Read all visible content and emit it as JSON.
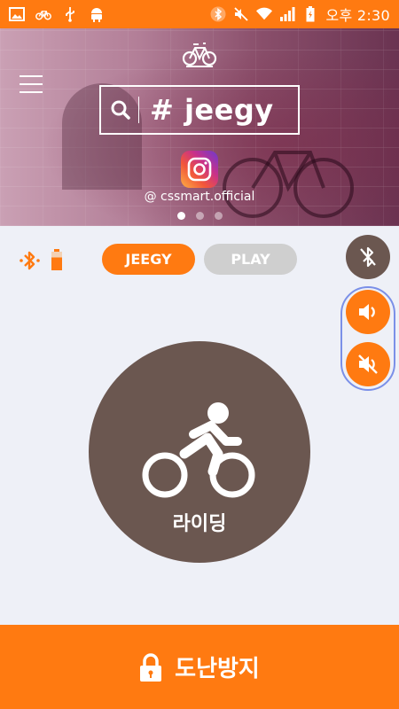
{
  "statusbar": {
    "time": "오후 2:30",
    "left_icons": [
      "image-icon",
      "bike-icon",
      "usb-icon",
      "android-icon"
    ],
    "right_icons": [
      "bluetooth-icon",
      "mute-icon",
      "wifi-icon",
      "signal-icon",
      "battery-icon"
    ]
  },
  "hero": {
    "search_text": "# jeegy",
    "instagram_handle": "@ cssmart.official",
    "carousel_count": 3,
    "carousel_active": 0
  },
  "tabs": [
    {
      "label": "JEEGY",
      "active": true
    },
    {
      "label": "PLAY",
      "active": false
    }
  ],
  "ride": {
    "label": "라이딩"
  },
  "bottom": {
    "label": "도난방지"
  },
  "colors": {
    "accent": "#ff7a11",
    "brown": "#6b5750",
    "inactive": "#cfcfcf",
    "highlight": "#7b90e8"
  }
}
